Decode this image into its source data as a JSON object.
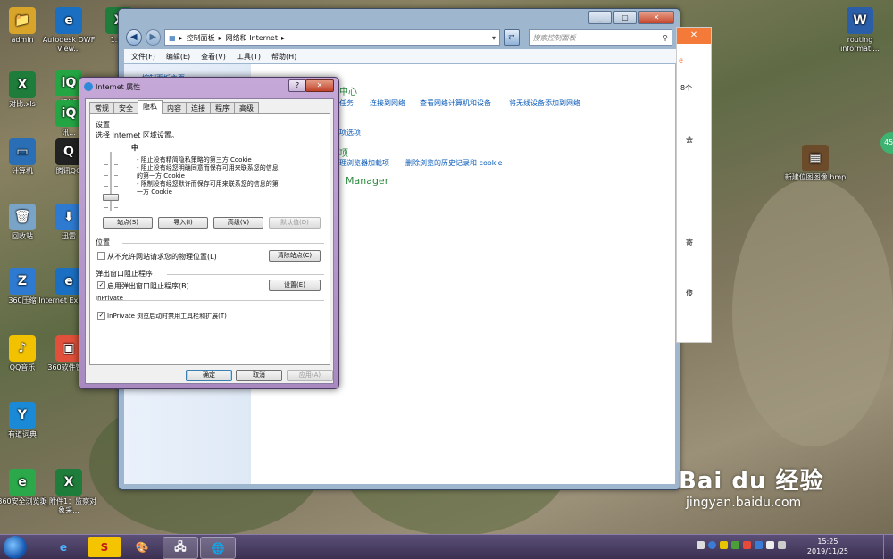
{
  "desktop": {
    "icons": [
      {
        "label": "admin",
        "color": "#d8a52a",
        "glyph": "📁"
      },
      {
        "label": "Autodesk DWF View...",
        "color": "#1b6fc2",
        "glyph": "e"
      },
      {
        "label": "1.xls",
        "color": "#1e7d3a",
        "glyph": "X"
      },
      {
        "label": "iQIYI",
        "color": "#23a543",
        "glyph": "iQ"
      },
      {
        "label": "对比.xls",
        "color": "#1e7d3a",
        "glyph": "X"
      },
      {
        "label": "讯...",
        "color": "#23a543",
        "glyph": "iQ"
      },
      {
        "label": "计算机",
        "color": "#2a6fb5",
        "glyph": "▭"
      },
      {
        "label": "腾讯QQ",
        "color": "#222222",
        "glyph": "Q"
      },
      {
        "label": "回收站",
        "color": "#7aa3c8",
        "glyph": "🗑"
      },
      {
        "label": "迅雷",
        "color": "#2d7ad0",
        "glyph": "⬇"
      },
      {
        "label": "360压缩",
        "color": "#2d7ad0",
        "glyph": "Z"
      },
      {
        "label": "Internet Explorer",
        "color": "#1b6fc2",
        "glyph": "e"
      },
      {
        "label": "QQ音乐",
        "color": "#f2c200",
        "glyph": "♪"
      },
      {
        "label": "360软件管家",
        "color": "#e0503a",
        "glyph": "▣"
      },
      {
        "label": "有道词典",
        "color": "#1b8ad6",
        "glyph": "Y"
      },
      {
        "label": "360安全浏览器",
        "color": "#2aa84a",
        "glyph": "e"
      },
      {
        "label": "1_附件1：监察对象采...",
        "color": "#1e7d3a",
        "glyph": "X"
      },
      {
        "label": "routing informati...",
        "color": "#2b5ea8",
        "glyph": "W"
      },
      {
        "label": "新建位图图像.bmp",
        "color": "#6b4b2a",
        "glyph": "▦"
      }
    ]
  },
  "explorer": {
    "breadcrumb": [
      "控制面板",
      "网络和 Internet"
    ],
    "search_placeholder": "搜索控制面板",
    "menu": [
      "文件(F)",
      "编辑(E)",
      "查看(V)",
      "工具(T)",
      "帮助(H)"
    ],
    "left_title": "控制面板主页",
    "heading_partial": "中心",
    "links_row": [
      "任务",
      "连接到网络",
      "查看网络计算机和设备",
      "将无线设备添加到网络"
    ],
    "link_options": "项选项",
    "heading2_partial": "项",
    "links_row2": [
      "理浏览器加载项",
      "删除浏览的历史记录和 cookie"
    ],
    "heading3_partial": "Manager"
  },
  "side_strip": {
    "close": "✕",
    "texts": [
      "e",
      "8个",
      "会",
      "寄",
      "傻"
    ]
  },
  "dialog": {
    "title": "Internet 属性",
    "help": "?",
    "close": "✕",
    "tabs": [
      "常规",
      "安全",
      "隐私",
      "内容",
      "连接",
      "程序",
      "高级"
    ],
    "active_tab": "隐私",
    "settings": {
      "section": "设置",
      "prompt": "选择 Internet 区域设置。",
      "level": "中",
      "desc_lines": [
        "- 阻止没有精简隐私策略的第三方 Cookie",
        "- 阻止没有经您明确同意而保存可用来联系您的信息",
        "的第一方 Cookie",
        "- 限制没有经您默许而保存可用来联系您的信息的第",
        "一方 Cookie"
      ],
      "slider_level_index": 2,
      "slider_levels_count": 6
    },
    "buttons_row": [
      "站点(S)",
      "导入(I)",
      "高级(V)",
      "默认值(D)"
    ],
    "location": {
      "section": "位置",
      "checkbox_label": "从不允许网站请求您的物理位置(L)",
      "checked": false,
      "button": "清除站点(C)"
    },
    "popup": {
      "section": "弹出窗口阻止程序",
      "checkbox_label": "启用弹出窗口阻止程序(B)",
      "checked": true,
      "button": "设置(E)"
    },
    "inprivate": {
      "section": "InPrivate",
      "checkbox_label": "InPrivate 浏览启动时禁用工具栏和扩展(T)",
      "checked": true
    },
    "footer": [
      "确定",
      "取消",
      "应用(A)"
    ]
  },
  "taskbar": {
    "apps": [
      "e",
      "S",
      "🎨",
      "🖧",
      "🌐"
    ],
    "time": "15:25",
    "date": "2019/11/25"
  },
  "watermark": {
    "brand": "Bai du 经验",
    "url": "jingyan.baidu.com"
  },
  "badge": "45"
}
